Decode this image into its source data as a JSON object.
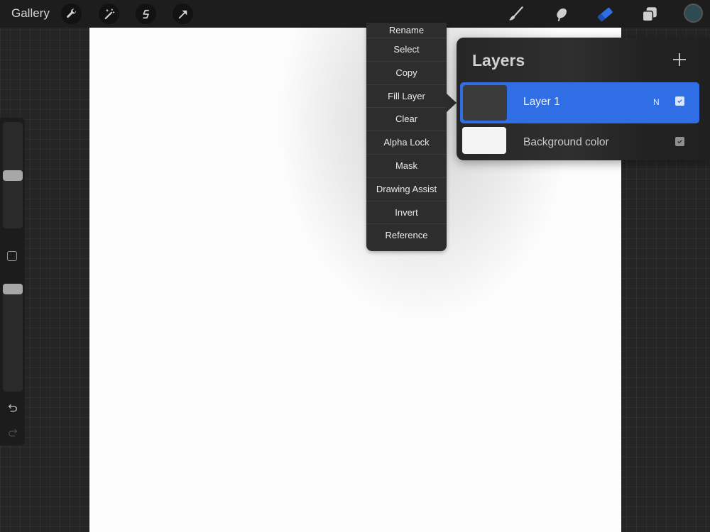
{
  "topbar": {
    "gallery_label": "Gallery",
    "left_tools": [
      {
        "name": "actions",
        "icon": "wrench-icon"
      },
      {
        "name": "adjustments",
        "icon": "magic-wand-icon"
      },
      {
        "name": "selection",
        "icon": "selection-s-icon"
      },
      {
        "name": "transform",
        "icon": "arrow-cursor-icon"
      }
    ],
    "right_tools": [
      {
        "name": "brush",
        "icon": "brush-icon",
        "active": false
      },
      {
        "name": "smudge",
        "icon": "smudge-finger-icon",
        "active": false
      },
      {
        "name": "eraser",
        "icon": "eraser-icon",
        "active": true
      },
      {
        "name": "layers",
        "icon": "layers-icon",
        "active": false
      }
    ],
    "current_color": "#2e4a52",
    "active_tool_color": "#2f6ee4"
  },
  "sidebar": {
    "brush_size_level": 0.5,
    "opacity_level": 0.0
  },
  "context_menu": {
    "items": [
      "Rename",
      "Select",
      "Copy",
      "Fill Layer",
      "Clear",
      "Alpha Lock",
      "Mask",
      "Drawing Assist",
      "Invert",
      "Reference"
    ]
  },
  "layers_panel": {
    "title": "Layers",
    "add_icon": "plus-icon",
    "layers": [
      {
        "name": "Layer 1",
        "blend_mode": "N",
        "visible": true,
        "selected": true,
        "thumb_color": "#3b3b3b"
      },
      {
        "name": "Background color",
        "blend_mode": "",
        "visible": true,
        "selected": false,
        "thumb_color": "#f4f4f4"
      }
    ]
  }
}
